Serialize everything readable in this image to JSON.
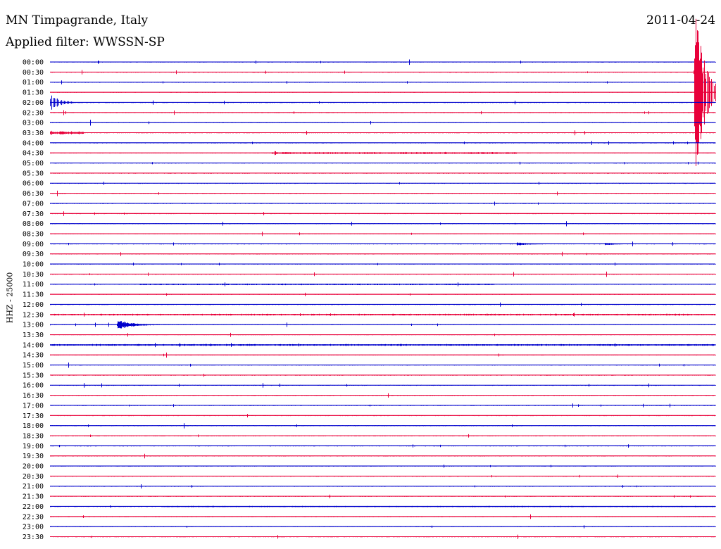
{
  "header": {
    "station": "MN Timpagrande, Italy",
    "date": "2011-04-24",
    "filter": "Applied filter: WWSSN-SP"
  },
  "axis": {
    "ylabel": "HHZ - 25000"
  },
  "colors": {
    "trace_a": "#0000cc",
    "trace_b": "#e8003a"
  },
  "chart_data": {
    "type": "line",
    "title": "MN Timpagrande, Italy",
    "subtitle": "Applied filter: WWSSN-SP",
    "ylabel": "HHZ - 25000",
    "channel": "HHZ",
    "scale": 25000,
    "date": "2011-04-24",
    "row_minutes": 30,
    "tick_labels": [
      "00:00",
      "00:30",
      "01:00",
      "01:30",
      "02:00",
      "02:30",
      "03:00",
      "03:30",
      "04:00",
      "04:30",
      "05:00",
      "05:30",
      "06:00",
      "06:30",
      "07:00",
      "07:30",
      "08:00",
      "08:30",
      "09:00",
      "09:30",
      "10:00",
      "10:30",
      "11:00",
      "11:30",
      "12:00",
      "12:30",
      "13:00",
      "13:30",
      "14:00",
      "14:30",
      "15:00",
      "15:30",
      "16:00",
      "16:30",
      "17:00",
      "17:30",
      "18:00",
      "18:30",
      "19:00",
      "19:30",
      "20:00",
      "20:30",
      "21:00",
      "21:30",
      "22:00",
      "22:30",
      "23:00",
      "23:30"
    ],
    "row_colors": [
      "blue",
      "red"
    ],
    "events": [
      {
        "start": "01:59",
        "duration_min": 2.0,
        "peak_rows": 9.0,
        "decay": "long",
        "label": ""
      },
      {
        "start": "13:03",
        "duration_min": 2.5,
        "peak_rows": 0.45,
        "decay": "medium",
        "label": ""
      },
      {
        "start": "09:21",
        "duration_min": 1.5,
        "peak_rows": 0.15,
        "decay": "short",
        "label": ""
      },
      {
        "start": "09:25",
        "duration_min": 1.3,
        "peak_rows": 0.12,
        "decay": "short",
        "label": ""
      }
    ],
    "noise_bursts": [
      {
        "start": "03:30",
        "duration_min": 1.5,
        "level": 0.12
      },
      {
        "start": "04:40",
        "duration_min": 11,
        "level": 0.06
      },
      {
        "start": "14:00",
        "duration_min": 30,
        "level": 0.05
      },
      {
        "start": "12:30",
        "duration_min": 30,
        "level": 0.05
      },
      {
        "start": "11:04",
        "duration_min": 16,
        "level": 0.04
      },
      {
        "start": "22:05",
        "duration_min": 25,
        "level": 0.03
      }
    ]
  }
}
